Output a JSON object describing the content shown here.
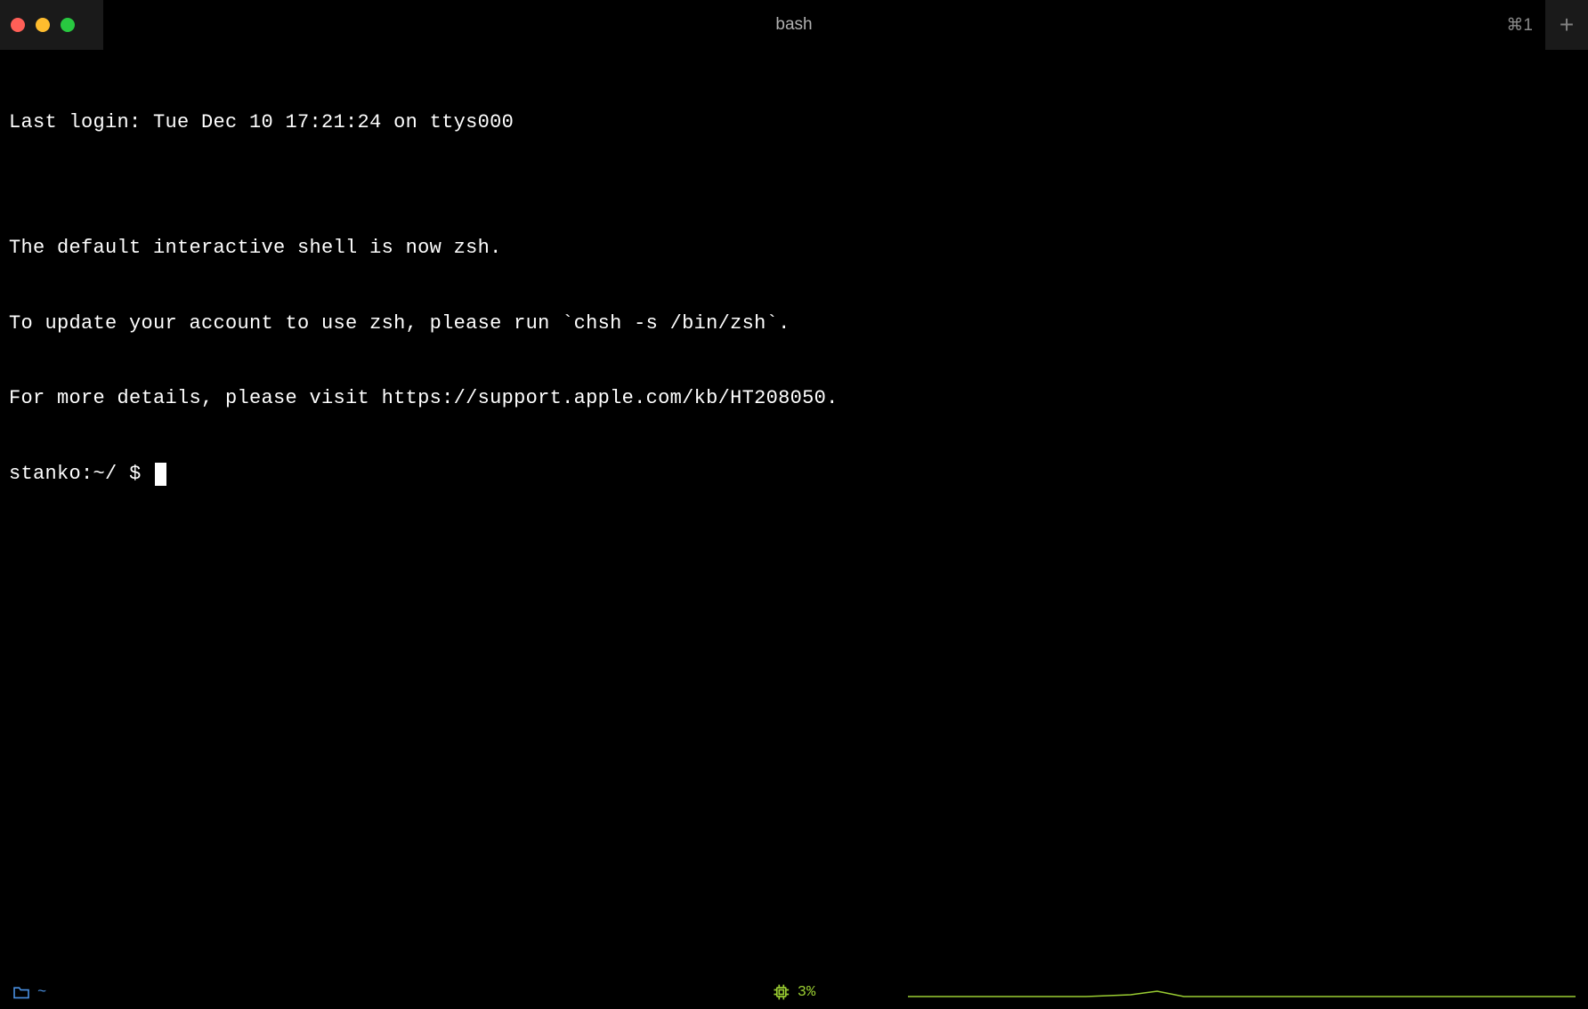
{
  "titlebar": {
    "window_title": "bash",
    "tab_shortcut": "⌘1",
    "new_tab_label": "+"
  },
  "terminal": {
    "lines": [
      "Last login: Tue Dec 10 17:21:24 on ttys000",
      "",
      "The default interactive shell is now zsh.",
      "To update your account to use zsh, please run `chsh -s /bin/zsh`.",
      "For more details, please visit https://support.apple.com/kb/HT208050."
    ],
    "prompt": {
      "host": "stanko",
      "path": "~/",
      "symbol": "$"
    }
  },
  "statusbar": {
    "path_label": "~",
    "cpu_percent": "3%"
  },
  "colors": {
    "accent_blue": "#4a90e2",
    "accent_green": "#9acd32",
    "traffic_red": "#ff5f57",
    "traffic_yellow": "#febc2e",
    "traffic_green": "#28c840"
  }
}
